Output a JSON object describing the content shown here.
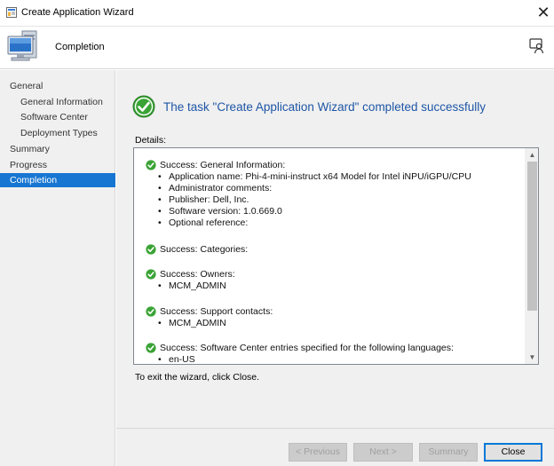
{
  "window": {
    "title": "Create Application Wizard",
    "close_glyph": "✕"
  },
  "header": {
    "title": "Completion",
    "icon": "computer-icon",
    "help_icon": "help-feedback-icon"
  },
  "sidebar": {
    "items": [
      {
        "label": "General",
        "level": 1,
        "active": false
      },
      {
        "label": "General Information",
        "level": 2,
        "active": false
      },
      {
        "label": "Software Center",
        "level": 2,
        "active": false
      },
      {
        "label": "Deployment Types",
        "level": 2,
        "active": false
      },
      {
        "label": "Summary",
        "level": 1,
        "active": false
      },
      {
        "label": "Progress",
        "level": 1,
        "active": false
      },
      {
        "label": "Completion",
        "level": 1,
        "active": true
      }
    ]
  },
  "main": {
    "success_message": "The task \"Create Application Wizard\" completed successfully",
    "details_label": "Details:",
    "exit_text": "To exit the wizard, click Close."
  },
  "details": {
    "groups": [
      {
        "title": "Success: General Information:",
        "items": [
          "Application name: Phi-4-mini-instruct x64 Model for Intel iNPU/iGPU/CPU",
          "Administrator comments:",
          "Publisher: Dell, Inc.",
          "Software version: 1.0.669.0",
          "Optional reference:"
        ]
      },
      {
        "title": "Success: Categories:",
        "items": []
      },
      {
        "title": "Success: Owners:",
        "items": [
          "MCM_ADMIN"
        ]
      },
      {
        "title": "Success: Support contacts:",
        "items": [
          "MCM_ADMIN"
        ]
      },
      {
        "title": "Success: Software Center entries specified for the following languages:",
        "items": [
          "en-US"
        ]
      }
    ]
  },
  "footer": {
    "previous_label": "< Previous",
    "next_label": "Next >",
    "summary_label": "Summary",
    "close_label": "Close"
  },
  "colors": {
    "accent": "#1776d2",
    "heading": "#1e56a6",
    "success": "#3aa335"
  }
}
